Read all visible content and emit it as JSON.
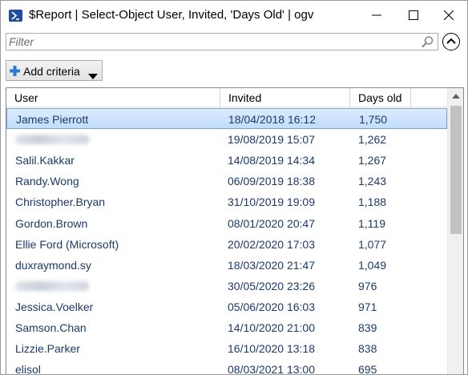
{
  "window": {
    "title": "$Report | Select-Object User, Invited, 'Days Old' | ogv",
    "app_icon": "powershell-icon"
  },
  "filter": {
    "placeholder": "Filter",
    "value": ""
  },
  "toolbar": {
    "add_criteria_label": "Add criteria"
  },
  "grid": {
    "columns": [
      "User",
      "Invited",
      "Days old"
    ],
    "rows": [
      {
        "user": "James Pierrott",
        "invited": "18/04/2018 16:12",
        "days": "1,750",
        "selected": true
      },
      {
        "user": "",
        "redacted": true,
        "invited": "19/08/2019 15:07",
        "days": "1,262"
      },
      {
        "user": "Salil.Kakkar",
        "invited": "14/08/2019 14:34",
        "days": "1,267"
      },
      {
        "user": "Randy.Wong",
        "invited": "06/09/2019 18:38",
        "days": "1,243"
      },
      {
        "user": "Christopher.Bryan",
        "invited": "31/10/2019 19:09",
        "days": "1,188"
      },
      {
        "user": "Gordon.Brown",
        "invited": "08/01/2020 20:47",
        "days": "1,119"
      },
      {
        "user": "Ellie Ford (Microsoft)",
        "invited": "20/02/2020 17:03",
        "days": "1,077"
      },
      {
        "user": "duxraymond.sy",
        "invited": "18/03/2020 21:47",
        "days": "1,049"
      },
      {
        "user": "",
        "redacted": true,
        "invited": "30/05/2020 23:26",
        "days": "976"
      },
      {
        "user": "Jessica.Voelker",
        "invited": "05/06/2020 16:03",
        "days": "971"
      },
      {
        "user": "Samson.Chan",
        "invited": "14/10/2020 21:00",
        "days": "839"
      },
      {
        "user": "Lizzie.Parker",
        "invited": "16/10/2020 13:18",
        "days": "838"
      },
      {
        "user": "elisol",
        "invited": "08/03/2021 13:00",
        "days": "695"
      }
    ]
  },
  "colors": {
    "row_text": "#1b3a6b",
    "selection": "#c1dcfc",
    "selection_border": "#7da2ce"
  }
}
